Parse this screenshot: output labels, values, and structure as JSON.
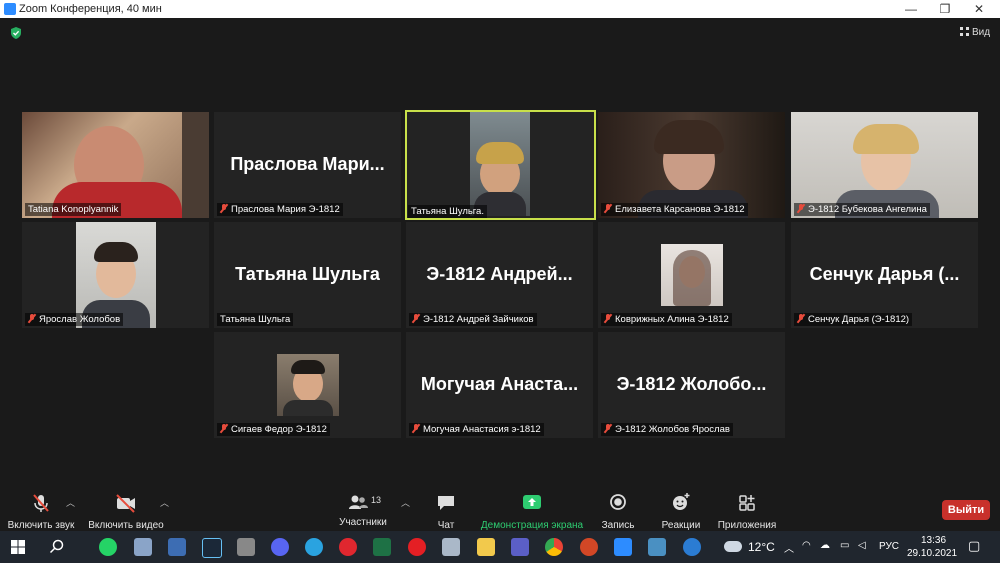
{
  "window": {
    "title": "Zoom Конференция, 40 мин",
    "minimize": "—",
    "maximize": "❐",
    "close": "✕"
  },
  "view_button": {
    "label": "Вид",
    "icon": "grid-icon"
  },
  "security_icon": {
    "icon": "shield-icon",
    "color": "#27ae60"
  },
  "active_speaker_color": "#c8e04a",
  "tiles": [
    {
      "label": "Tatiana Konoplyannik",
      "muted": false,
      "big": "",
      "video": true
    },
    {
      "label": "Праслова Мария Э-1812",
      "muted": true,
      "big": "Праслова Мари...",
      "video": false
    },
    {
      "label": "Татьяна Шульга.",
      "muted": false,
      "big": "",
      "video": true,
      "active": true
    },
    {
      "label": "Елизавета Карсанова Э-1812",
      "muted": true,
      "big": "",
      "video": true
    },
    {
      "label": "Э-1812 Бубекова Ангелина",
      "muted": true,
      "big": "",
      "video": true
    },
    {
      "label": "Ярослав Жолобов",
      "muted": true,
      "big": "",
      "video": true
    },
    {
      "label": "Татьяна Шульга",
      "muted": false,
      "big": "Татьяна Шульга",
      "video": false
    },
    {
      "label": "Э-1812 Андрей Зайчиков",
      "muted": true,
      "big": "Э-1812 Андрей...",
      "video": false
    },
    {
      "label": "Коврижных Алина Э-1812",
      "muted": true,
      "big": "",
      "video": true
    },
    {
      "label": "Сенчук Дарья (Э-1812)",
      "muted": true,
      "big": "Сенчук Дарья (...",
      "video": false
    },
    {
      "label": "Сигаев Федор Э-1812",
      "muted": true,
      "big": "",
      "video": true
    },
    {
      "label": "Могучая Анастасия э-1812",
      "muted": true,
      "big": "Могучая Анаста...",
      "video": false
    },
    {
      "label": "Э-1812 Жолобов Ярослав",
      "muted": true,
      "big": "Э-1812 Жолобо...",
      "video": false
    }
  ],
  "toolbar": {
    "audio": {
      "label": "Включить звук",
      "icon": "mic-muted-icon"
    },
    "video": {
      "label": "Включить видео",
      "icon": "camera-off-icon"
    },
    "participants": {
      "label": "Участники",
      "count": "13",
      "icon": "participants-icon"
    },
    "chat": {
      "label": "Чат",
      "icon": "chat-icon"
    },
    "share": {
      "label": "Демонстрация экрана",
      "icon": "share-screen-icon",
      "color": "#2ecc71"
    },
    "record": {
      "label": "Запись",
      "icon": "record-icon"
    },
    "reactions": {
      "label": "Реакции",
      "icon": "emoji-icon"
    },
    "apps": {
      "label": "Приложения",
      "icon": "apps-icon"
    },
    "leave": {
      "label": "Выйти",
      "color": "#c8312b"
    }
  },
  "taskbar": {
    "weather": "12°C",
    "language": "РУС",
    "time": "13:36",
    "date": "29.10.2021"
  }
}
